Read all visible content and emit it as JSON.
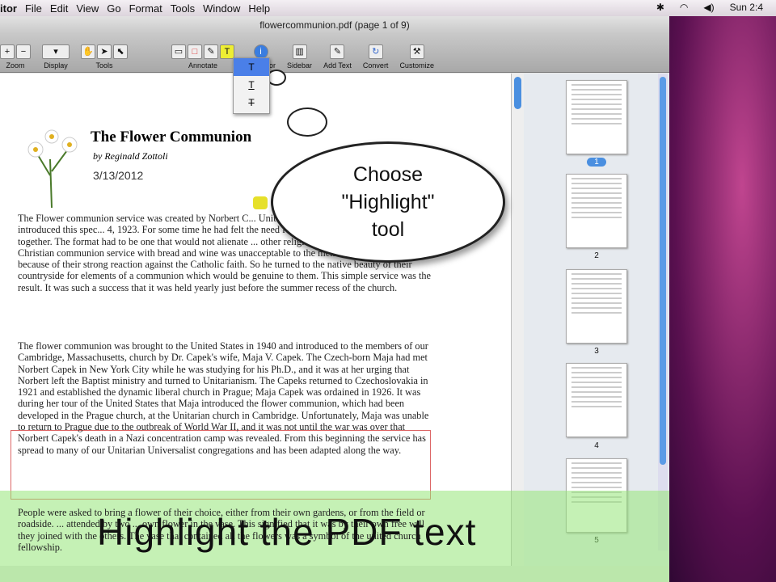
{
  "menubar": {
    "app": "itor",
    "items": [
      "File",
      "Edit",
      "View",
      "Go",
      "Format",
      "Tools",
      "Window",
      "Help"
    ],
    "clock": "Sun 2:4"
  },
  "window": {
    "title": "flowercommunion.pdf (page 1 of 9)"
  },
  "toolbar": {
    "groups": [
      {
        "label": "Zoom"
      },
      {
        "label": "Display"
      },
      {
        "label": "Tools"
      },
      {
        "label": "Annotate"
      },
      {
        "label": "Inspector"
      },
      {
        "label": "Sidebar"
      },
      {
        "label": "Add Text"
      },
      {
        "label": "Convert"
      },
      {
        "label": "Customize"
      }
    ]
  },
  "annotate_menu": {
    "items": [
      "T",
      "T",
      "T"
    ]
  },
  "document": {
    "title": "The Flower Communion",
    "author": "by Reginald Zottoli",
    "date": "3/13/2012",
    "paragraphs": [
      "The Flower communion service was created by Norbert C... Unitarian Church in Czechoslovakia. He introduced this spec... 4, 1923. For some time he had felt the need for some symbolic rit... more closely together. The format had to be one that would not alienate ... other religious traditions. The traditional Christian communion service with bread and wine was unacceptable to the members of his congregation because of their strong reaction against the Catholic faith. So he turned to the native beauty of their countryside for elements of a communion which would be genuine to them. This simple service was the result. It was such a success that it was held yearly just before the summer recess of the church.",
      "The flower communion was brought to the United States in 1940 and introduced to the members of our Cambridge, Massachusetts, church by Dr. Capek's wife, Maja V. Capek. The Czech-born Maja had met Norbert Capek in New York City while he was studying for his Ph.D., and it was at her urging that Norbert left the Baptist ministry and turned to Unitarianism. The Capeks returned to Czechoslovakia in 1921 and established the dynamic liberal church in Prague; Maja Capek was ordained in 1926. It was during her tour of the United States that Maja introduced the flower communion, which had been developed in the Prague church, at the Unitarian church in Cambridge. Unfortunately, Maja was unable to return to Prague due to the outbreak of World War II, and it was not until the war was over that Norbert Capek's death in a Nazi concentration camp was revealed. From this beginning the service has spread to many of our Unitarian Universalist congregations and has been adapted along the way.",
      "People were asked to bring a flower of their choice, either from their own gardens, or from the field or roadside. ... attended by two ... own flower in the vase. This signified that it was by their own free will they joined with the others. The vase that contained all the flowers was a symbol of the united church fellowship."
    ]
  },
  "sidebar": {
    "pages": [
      "1",
      "2",
      "3",
      "4",
      "5"
    ]
  },
  "callout": {
    "text": "Choose \"Highlight\" tool"
  },
  "caption": {
    "text": "Highlight the PDF text"
  }
}
